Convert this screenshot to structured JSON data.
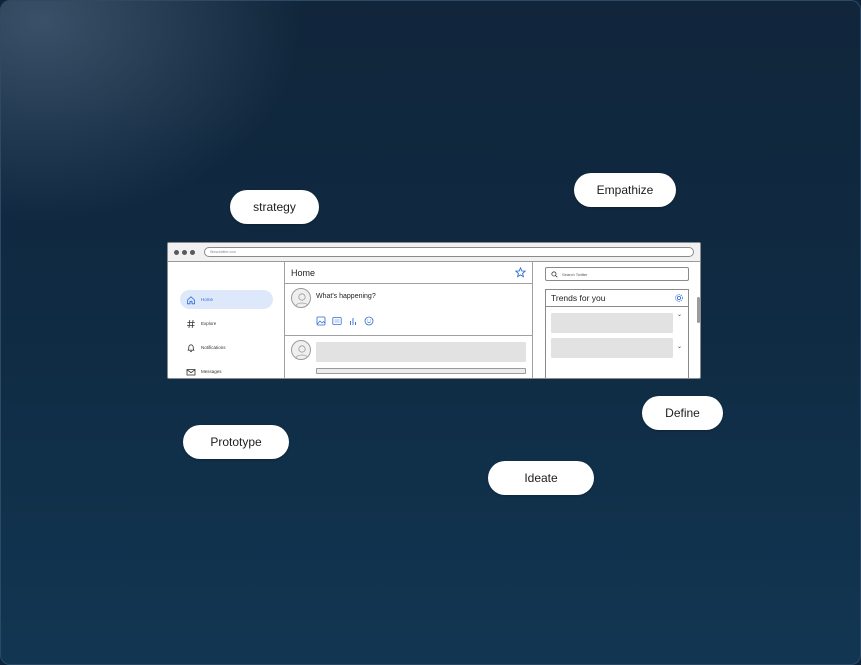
{
  "labels": {
    "strategy": "strategy",
    "empathize": "Empathize",
    "prototype": "Prototype",
    "define": "Define",
    "ideate": "Ideate"
  },
  "browser": {
    "url": "Www.twitter.com"
  },
  "sidebar": {
    "items": [
      {
        "label": "Home",
        "icon": "home-icon",
        "active": true
      },
      {
        "label": "Explore",
        "icon": "hashtag-icon",
        "active": false
      },
      {
        "label": "Notifications",
        "icon": "bell-icon",
        "active": false
      },
      {
        "label": "Messages",
        "icon": "mail-icon",
        "active": false
      }
    ]
  },
  "main": {
    "title": "Home",
    "compose_placeholder": "What's happening?",
    "compose_icons": [
      "image-icon",
      "gif-icon",
      "poll-icon",
      "emoji-icon"
    ]
  },
  "right": {
    "search_placeholder": "Search Twitter",
    "trends_title": "Trends for you"
  },
  "colors": {
    "accent": "#2b6bd8",
    "active_bg": "#dde8fb",
    "background": "#0f2438"
  }
}
